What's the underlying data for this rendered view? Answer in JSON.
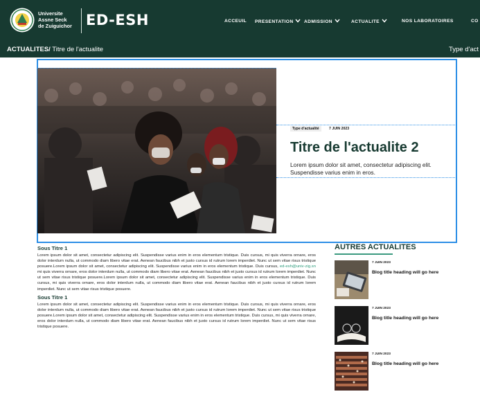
{
  "header": {
    "university_lines": [
      "Universite",
      "Assne Seck",
      "de Zuiguichor"
    ],
    "brand": "ED-ESH",
    "nav": [
      {
        "label": "ACCEUIL",
        "dropdown": false
      },
      {
        "label": "PRESENTATION",
        "dropdown": true
      },
      {
        "label": "ADMISSION",
        "dropdown": true
      },
      {
        "label": "ACTUALITE",
        "dropdown": true
      },
      {
        "label": "NOS LABORATOIRES",
        "dropdown": false
      },
      {
        "label": "CO",
        "dropdown": false
      }
    ]
  },
  "breadcrumb": {
    "section": "ACTUALITES/",
    "page": " Titre de l'actualite",
    "right_label": "Type d'act"
  },
  "hero": {
    "type_badge": "Type d'actualité",
    "date": "7 JUIN 2023",
    "title": "Titre de l'actualite 2",
    "text": "Lorem ipsum dolor sit amet, consectetur adipiscing elit. Suspendisse varius enim in eros."
  },
  "article": {
    "section1_title": "Sous Titre 1",
    "section1_before_link": "Lorem ipsum dolor sit amet, consectetur adipiscing elit. Suspendisse varius enim in eros elementum tristique. Duis cursus, mi quis viverra ornare, eros dolor interdum nulla, ut commodo diam libero vitae erat. Aenean faucibus nibh et justo cursus id rutrum lorem imperdiet. Nunc ut sem vitae risus tristique posuere.Lorem ipsum dolor sit amet, consectetur adipiscing elit. Suspendisse varius enim in eros elementum tristique. Duis cursus,",
    "section1_link": "ed-esh@univ-zig.sn",
    "section1_after_link": "mi quis viverra ornare, eros dolor interdum nulla, ut commodo diam libero vitae erat. Aenean faucibus nibh et justo cursus id rutrum lorem imperdiet. Nunc ut sem vitae risus tristique posuere.Lorem ipsum dolor sit amet, consectetur adipiscing elit. Suspendisse varius enim in eros elementum tristique. Duis cursus, mi quis viverra ornare, eros dolor interdum nulla, ut commodo diam libero vitae erat. Aenean faucibus nibh et justo cursus id rutrum lorem imperdiet. Nunc ut sem vitae risus tristique posuere.",
    "section2_title": "Sous Titre 1",
    "section2_text": "Lorem ipsum dolor sit amet, consectetur adipiscing elit. Suspendisse varius enim in eros elementum tristique. Duis cursus, mi quis viverra ornare, eros dolor interdum nulla, ut commodo diam libero vitae erat. Aenean faucibus nibh et justo cursus id rutrum lorem imperdiet. Nunc ut sem vitae risus tristique posuere.Lorem ipsum dolor sit amet, consectetur adipiscing elit. Suspendisse varius enim in eros elementum tristique. Duis cursus, mi quis viverra ornare, eros dolor interdum nulla, ut commodo diam libero vitae erat. Aenean faucibus nibh et justo cursus id rutrum lorem imperdiet. Nunc ut sem vitae risus tristique posuere."
  },
  "aside": {
    "title": "AUTRES ACTUALITES",
    "items": [
      {
        "date": "7 JUIN 2023",
        "title": "Blog title heading will go here",
        "thumb": "laptop-desk-photo"
      },
      {
        "date": "7 JUIN 2023",
        "title": "Blog title heading will go here",
        "thumb": "glasses-book-photo"
      },
      {
        "date": "7 JUIN 2023",
        "title": "Blog title heading will go here",
        "thumb": "auditorium-photo"
      }
    ]
  },
  "colors": {
    "header_bg": "#173a31",
    "accent_green": "#3a9a7f",
    "selection_blue": "#2b8ee6"
  }
}
